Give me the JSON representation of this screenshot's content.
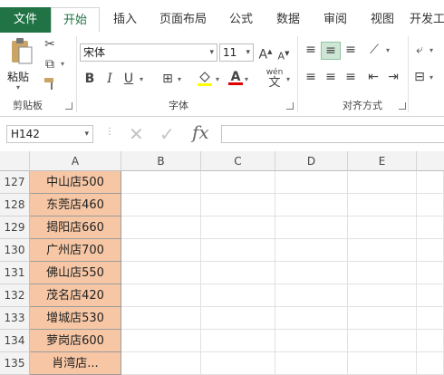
{
  "title_fragment": "...",
  "tabs": [
    "文件",
    "开始",
    "插入",
    "页面布局",
    "公式",
    "数据",
    "审阅",
    "视图",
    "开发工"
  ],
  "clipboard": {
    "paste_label": "粘贴",
    "group_label": "剪贴板"
  },
  "font": {
    "name": "宋体",
    "size": "11",
    "group_label": "字体",
    "grow_label": "A",
    "shrink_label": "A",
    "bold": "B",
    "italic": "I",
    "underline": "U",
    "font_color_label": "A",
    "phonetic_label": "wén"
  },
  "alignment": {
    "group_label": "对齐方式"
  },
  "formula_bar": {
    "name_box": "H142",
    "fx_label": "fx",
    "cancel_label": "✕",
    "enter_label": "✓",
    "value": ""
  },
  "columns": [
    "A",
    "B",
    "C",
    "D",
    "E"
  ],
  "rows": [
    {
      "num": "127",
      "a": "中山店500"
    },
    {
      "num": "128",
      "a": "东莞店460"
    },
    {
      "num": "129",
      "a": "揭阳店660"
    },
    {
      "num": "130",
      "a": "广州店700"
    },
    {
      "num": "131",
      "a": "佛山店550"
    },
    {
      "num": "132",
      "a": "茂名店420"
    },
    {
      "num": "133",
      "a": "增城店530"
    },
    {
      "num": "134",
      "a": "萝岗店600"
    },
    {
      "num": "135",
      "a": "肖湾店..."
    }
  ],
  "colors": {
    "accent": "#217346",
    "cell_fill": "#f7c7a5"
  }
}
